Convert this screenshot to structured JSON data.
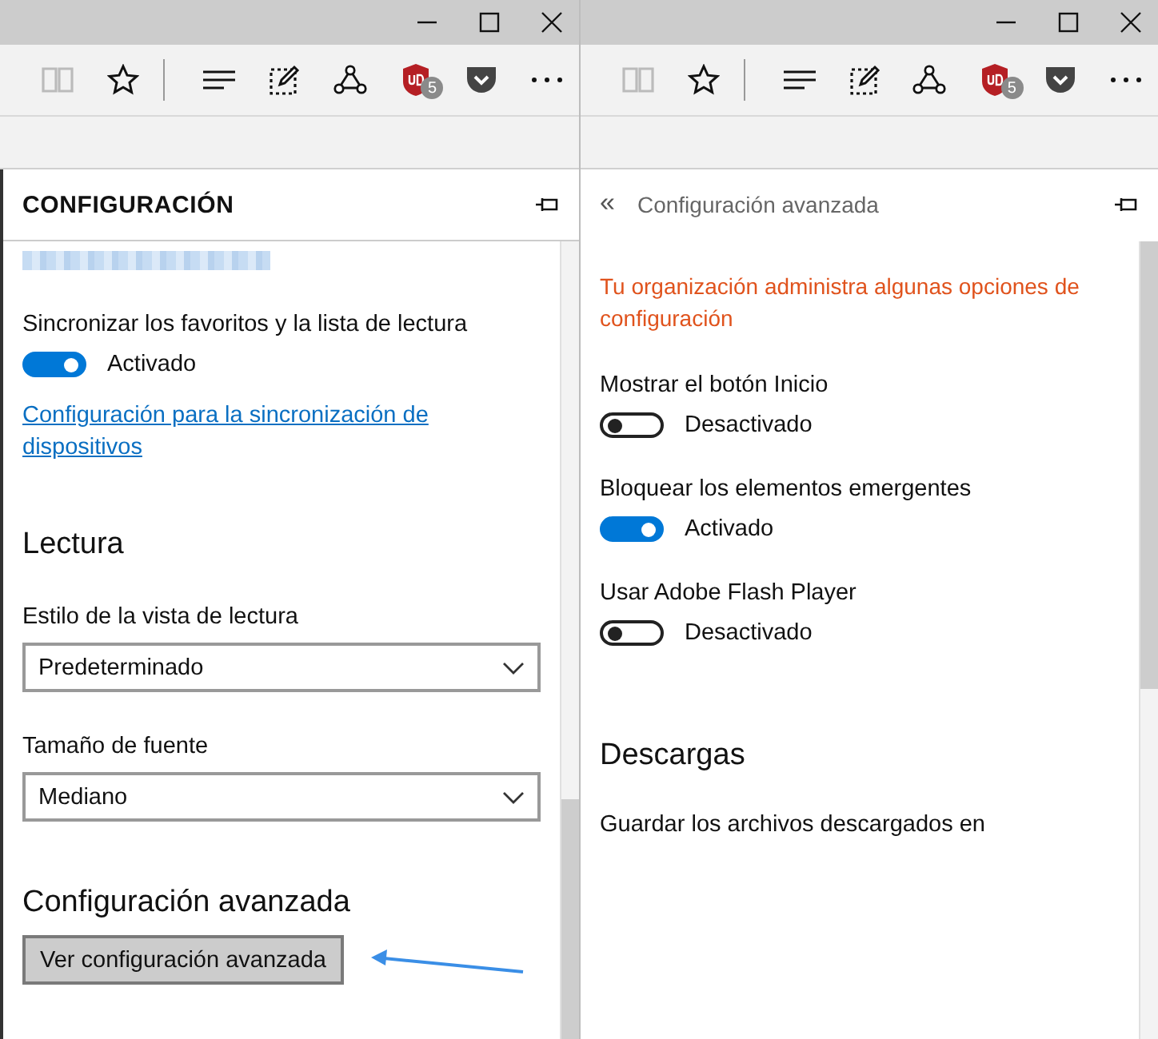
{
  "panes": [
    {
      "toolbar": {
        "badge": "5"
      },
      "header": {
        "kind": "title",
        "text": "CONFIGURACIÓN"
      },
      "items": [
        {
          "kind": "redacted"
        },
        {
          "kind": "label",
          "text": "Sincronizar los favoritos y la lista de lectura"
        },
        {
          "kind": "toggle",
          "on": true,
          "text": "Activado"
        },
        {
          "kind": "link",
          "text": "Configuración para la sincronización de dispositivos"
        },
        {
          "kind": "heading",
          "text": "Lectura"
        },
        {
          "kind": "label",
          "text": "Estilo de la vista de lectura"
        },
        {
          "kind": "select",
          "value": "Predeterminado"
        },
        {
          "kind": "label",
          "text": "Tamaño de fuente"
        },
        {
          "kind": "select",
          "value": "Mediano"
        },
        {
          "kind": "heading",
          "text": "Configuración avanzada"
        },
        {
          "kind": "button",
          "text": "Ver configuración avanzada"
        }
      ]
    },
    {
      "toolbar": {
        "badge": "5"
      },
      "header": {
        "kind": "back",
        "back": "«",
        "text": "Configuración avanzada"
      },
      "items": [
        {
          "kind": "notice",
          "text": "Tu organización administra algunas opciones de configuración"
        },
        {
          "kind": "label",
          "text": "Mostrar el botón Inicio"
        },
        {
          "kind": "toggle",
          "on": false,
          "text": "Desactivado"
        },
        {
          "kind": "label",
          "text": "Bloquear los elementos emergentes"
        },
        {
          "kind": "toggle",
          "on": true,
          "text": "Activado"
        },
        {
          "kind": "label",
          "text": "Usar Adobe Flash Player"
        },
        {
          "kind": "toggle",
          "on": false,
          "text": "Desactivado"
        },
        {
          "kind": "heading",
          "text": "Descargas"
        },
        {
          "kind": "label",
          "text": "Guardar los archivos descargados en"
        }
      ]
    }
  ]
}
